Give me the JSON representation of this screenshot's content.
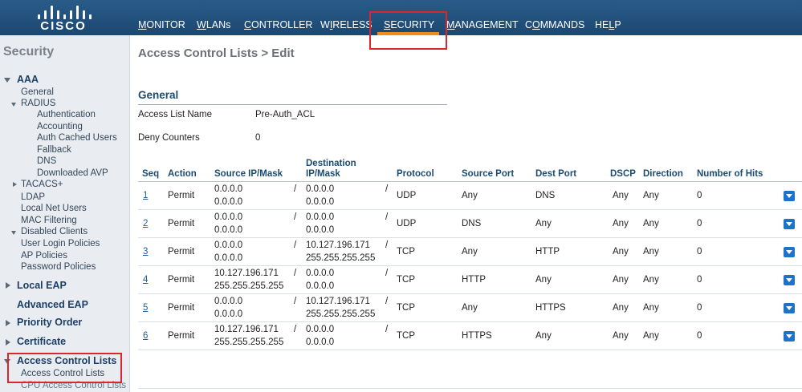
{
  "brand": {
    "logo_text": "CISCO"
  },
  "nav": [
    {
      "id": "monitor",
      "ul": "M",
      "rest": "ONITOR"
    },
    {
      "id": "wlans",
      "ul": "W",
      "rest": "LANs"
    },
    {
      "id": "controller",
      "ul": "C",
      "rest": "ONTROLLER"
    },
    {
      "id": "wireless",
      "pre": "W",
      "ul": "I",
      "rest": "RELESS"
    },
    {
      "id": "security",
      "ul": "S",
      "rest": "ECURITY"
    },
    {
      "id": "management",
      "ul": "M",
      "rest": "ANAGEMENT"
    },
    {
      "id": "commands",
      "pre": "C",
      "ul": "O",
      "rest": "MMANDS"
    },
    {
      "id": "help",
      "pre": "HE",
      "ul": "L",
      "rest": "P"
    }
  ],
  "sidebar": {
    "title": "Security",
    "items": {
      "aaa": "AAA",
      "general": "General",
      "radius": "RADIUS",
      "authentication": "Authentication",
      "accounting": "Accounting",
      "auth_cached_users": "Auth Cached Users",
      "fallback": "Fallback",
      "dns": "DNS",
      "downloaded_avp": "Downloaded AVP",
      "tacacs": "TACACS+",
      "ldap": "LDAP",
      "local_net_users": "Local Net Users",
      "mac_filtering": "MAC Filtering",
      "disabled_clients": "Disabled Clients",
      "user_login_policies": "User Login Policies",
      "ap_policies": "AP Policies",
      "password_policies": "Password Policies",
      "local_eap": "Local EAP",
      "advanced_eap": "Advanced EAP",
      "priority_order": "Priority Order",
      "certificate": "Certificate",
      "access_control_lists": "Access Control Lists",
      "access_control_lists_sub": "Access Control Lists",
      "cpu_access_control_lists": "CPU Access Control Lists"
    }
  },
  "main": {
    "page_title": "Access Control Lists > Edit",
    "section_title": "General",
    "access_list_name_label": "Access List Name",
    "access_list_name_value": "Pre-Auth_ACL",
    "deny_counters_label": "Deny Counters",
    "deny_counters_value": "0"
  },
  "table": {
    "headers": {
      "seq": "Seq",
      "action": "Action",
      "source_ip": "Source IP/Mask",
      "dest_ip_1": "Destination",
      "dest_ip_2": "IP/Mask",
      "protocol": "Protocol",
      "source_port": "Source Port",
      "dest_port": "Dest Port",
      "dscp": "DSCP",
      "direction": "Direction",
      "hits": "Number of Hits"
    },
    "rows": [
      {
        "seq": "1",
        "action": "Permit",
        "src_ip": "0.0.0.0",
        "src_mask": "0.0.0.0",
        "dst_ip": "0.0.0.0",
        "dst_mask": "0.0.0.0",
        "protocol": "UDP",
        "src_port": "Any",
        "dst_port": "DNS",
        "dscp": "Any",
        "direction": "Any",
        "hits": "0"
      },
      {
        "seq": "2",
        "action": "Permit",
        "src_ip": "0.0.0.0",
        "src_mask": "0.0.0.0",
        "dst_ip": "0.0.0.0",
        "dst_mask": "0.0.0.0",
        "protocol": "UDP",
        "src_port": "DNS",
        "dst_port": "Any",
        "dscp": "Any",
        "direction": "Any",
        "hits": "0"
      },
      {
        "seq": "3",
        "action": "Permit",
        "src_ip": "0.0.0.0",
        "src_mask": "0.0.0.0",
        "dst_ip": "10.127.196.171",
        "dst_mask": "255.255.255.255",
        "protocol": "TCP",
        "src_port": "Any",
        "dst_port": "HTTP",
        "dscp": "Any",
        "direction": "Any",
        "hits": "0"
      },
      {
        "seq": "4",
        "action": "Permit",
        "src_ip": "10.127.196.171",
        "src_mask": "255.255.255.255",
        "dst_ip": "0.0.0.0",
        "dst_mask": "0.0.0.0",
        "protocol": "TCP",
        "src_port": "HTTP",
        "dst_port": "Any",
        "dscp": "Any",
        "direction": "Any",
        "hits": "0"
      },
      {
        "seq": "5",
        "action": "Permit",
        "src_ip": "0.0.0.0",
        "src_mask": "0.0.0.0",
        "dst_ip": "10.127.196.171",
        "dst_mask": "255.255.255.255",
        "protocol": "TCP",
        "src_port": "Any",
        "dst_port": "HTTPS",
        "dscp": "Any",
        "direction": "Any",
        "hits": "0"
      },
      {
        "seq": "6",
        "action": "Permit",
        "src_ip": "10.127.196.171",
        "src_mask": "255.255.255.255",
        "dst_ip": "0.0.0.0",
        "dst_mask": "0.0.0.0",
        "protocol": "TCP",
        "src_port": "HTTPS",
        "dst_port": "Any",
        "dscp": "Any",
        "direction": "Any",
        "hits": "0"
      }
    ]
  },
  "colors": {
    "header": "#1b4872",
    "active_tab_underline": "#f08c1e",
    "highlight_box": "#d8272d",
    "link": "#1b5e9c"
  }
}
